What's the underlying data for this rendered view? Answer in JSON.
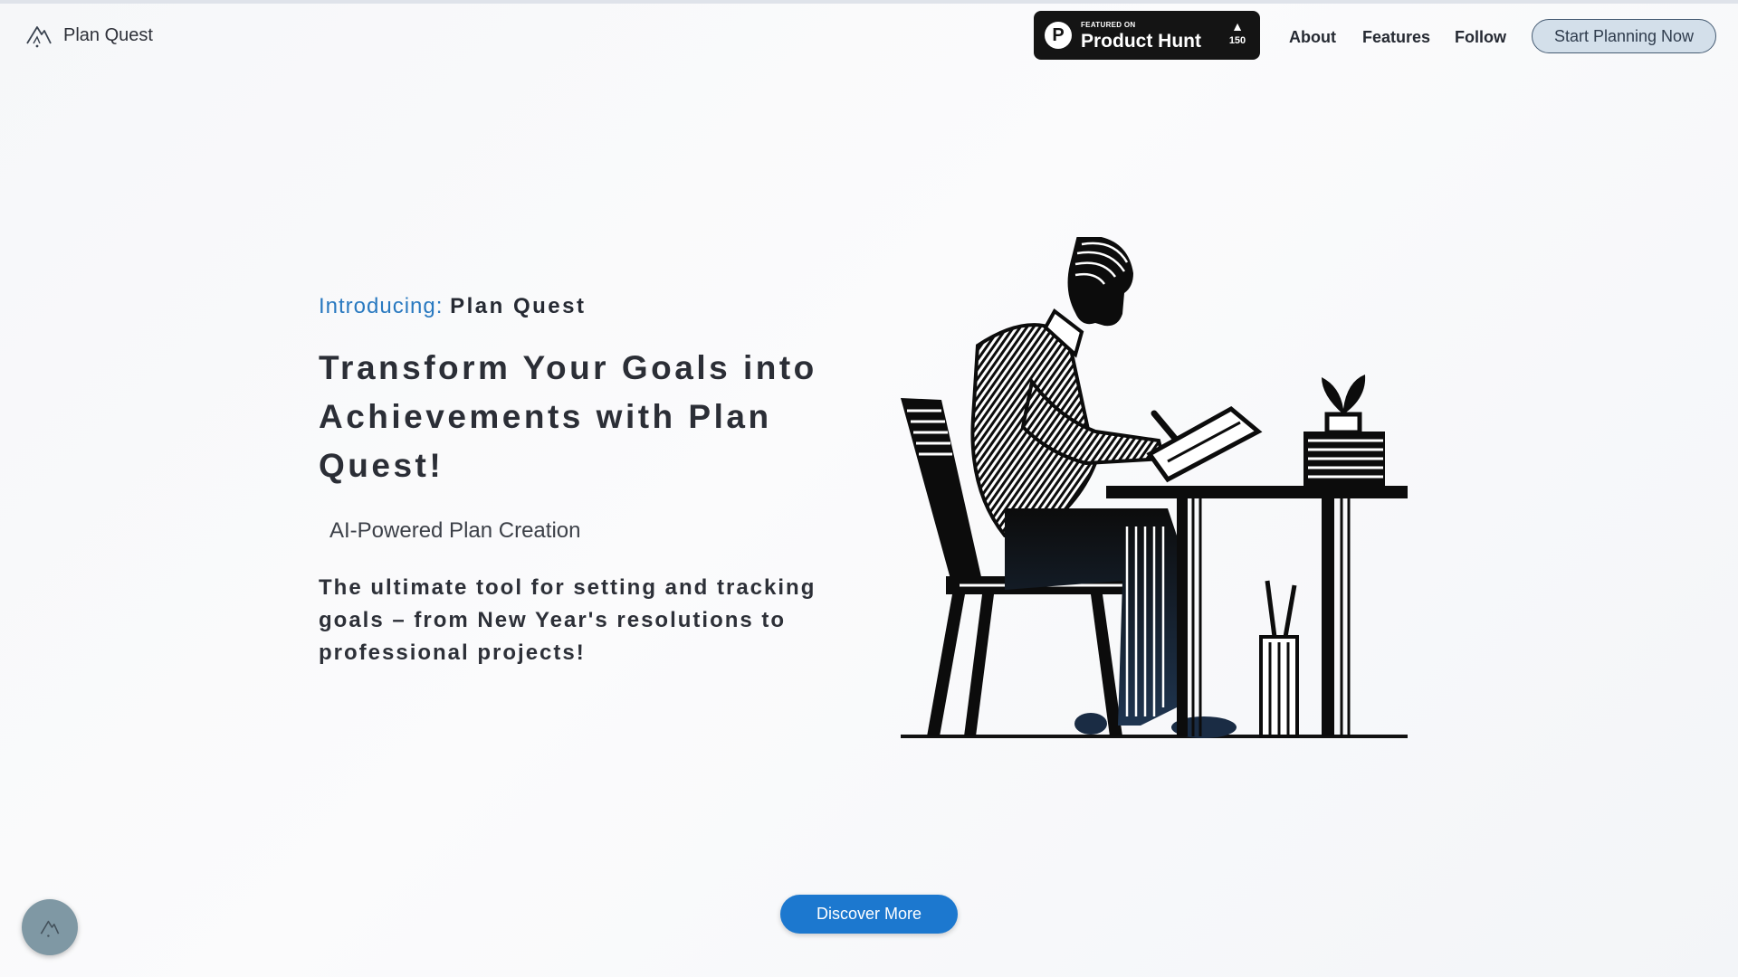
{
  "brand": {
    "name": "Plan Quest",
    "icon": "mountain-logo-icon"
  },
  "product_hunt": {
    "featured_label": "FEATURED ON",
    "name": "Product Hunt",
    "letter": "P",
    "upvote_icon": "triangle-up-icon",
    "upvotes": "150"
  },
  "nav": {
    "about": "About",
    "features": "Features",
    "follow": "Follow",
    "cta": "Start Planning Now"
  },
  "hero": {
    "intro_label": "Introducing:",
    "intro_name": "Plan Quest",
    "headline": "Transform Your Goals into Achievements with Plan Quest!",
    "subhead": "AI-Powered Plan Creation",
    "description": "The ultimate tool for setting and tracking goals – from New Year's resolutions to professional projects!",
    "discover_button": "Discover More"
  },
  "fab": {
    "icon": "mountain-logo-icon"
  },
  "colors": {
    "accent": "#1c78cf",
    "intro_blue": "#2979c0",
    "cta_bg": "#d3dfea",
    "badge_bg": "#141414"
  }
}
